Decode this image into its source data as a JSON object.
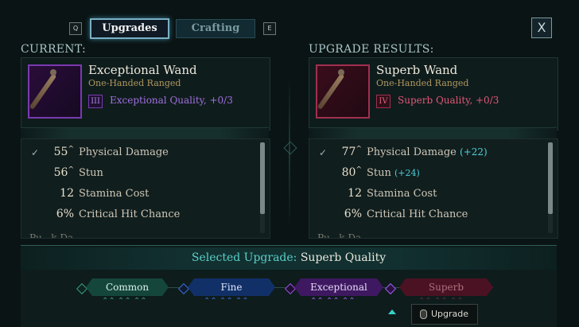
{
  "top_bar": {
    "prev_key": "Q",
    "next_key": "E",
    "tabs": [
      {
        "label": "Upgrades",
        "active": true
      },
      {
        "label": "Crafting",
        "active": false
      }
    ],
    "close_label": "X"
  },
  "current": {
    "heading": "CURRENT:",
    "item_name": "Exceptional Wand",
    "item_type": "One-Handed Ranged",
    "tier_numeral": "III",
    "quality": "Exceptional Quality, +0/3",
    "quality_color": "#a070e0",
    "frame_color": "#7a3ab0",
    "stats": [
      {
        "value": "55",
        "caret": "^",
        "label": "Physical Damage",
        "bonus": ""
      },
      {
        "value": "56",
        "caret": "^",
        "label": "Stun",
        "bonus": ""
      },
      {
        "value": "12",
        "caret": "",
        "label": "Stamina Cost",
        "bonus": ""
      },
      {
        "value": "6%",
        "caret": "",
        "label": "Critical Hit Chance",
        "bonus": ""
      }
    ],
    "cut_off_text": "Pu...k Da..."
  },
  "result": {
    "heading": "UPGRADE RESULTS:",
    "item_name": "Superb Wand",
    "item_type": "One-Handed Ranged",
    "tier_numeral": "IV",
    "quality": "Superb Quality, +0/3",
    "quality_color": "#e05878",
    "frame_color": "#a03050",
    "stats": [
      {
        "value": "77",
        "caret": "^",
        "label": "Physical Damage",
        "bonus": "(+22)"
      },
      {
        "value": "80",
        "caret": "^",
        "label": "Stun",
        "bonus": "(+24)"
      },
      {
        "value": "12",
        "caret": "",
        "label": "Stamina Cost",
        "bonus": ""
      },
      {
        "value": "6%",
        "caret": "",
        "label": "Critical Hit Chance",
        "bonus": ""
      }
    ],
    "cut_off_text": "Pu...k Da..."
  },
  "upgrade_track": {
    "selected_prefix": "Selected Upgrade:",
    "selected_value": "Superb Quality",
    "tiers": [
      {
        "label": "Common",
        "color": "#2e8a72"
      },
      {
        "label": "Fine",
        "color": "#2a60c0"
      },
      {
        "label": "Exceptional",
        "color": "#8a3ad0"
      },
      {
        "label": "Superb",
        "color": "#c02848"
      }
    ]
  },
  "tooltip": {
    "label": "Upgrade"
  }
}
